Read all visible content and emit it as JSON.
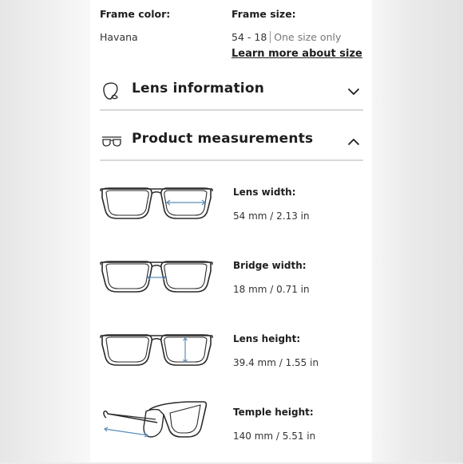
{
  "frame_color": {
    "label": "Frame color:",
    "value": "Havana"
  },
  "frame_size": {
    "label": "Frame size:",
    "value": "54 - 18",
    "note": "One size only",
    "link": "Learn more about size"
  },
  "lens_info": {
    "title": "Lens information",
    "icon": "lens-icon",
    "state": "collapsed"
  },
  "product_measurements": {
    "title": "Product measurements",
    "icon": "glasses-icon",
    "state": "expanded"
  },
  "measurements": [
    {
      "label": "Lens width:",
      "value": "54 mm / 2.13 in",
      "icon": "lens-width-glasses"
    },
    {
      "label": "Bridge width:",
      "value": "18 mm / 0.71 in",
      "icon": "bridge-width-glasses"
    },
    {
      "label": "Lens height:",
      "value": "39.4 mm / 1.55 in",
      "icon": "lens-height-glasses"
    },
    {
      "label": "Temple height:",
      "value": "140 mm / 5.51 in",
      "icon": "temple-length-glasses"
    }
  ],
  "colors": {
    "arrow": "#5b8db8",
    "stroke": "#2a2a2a",
    "divider": "#d8d8d8"
  }
}
